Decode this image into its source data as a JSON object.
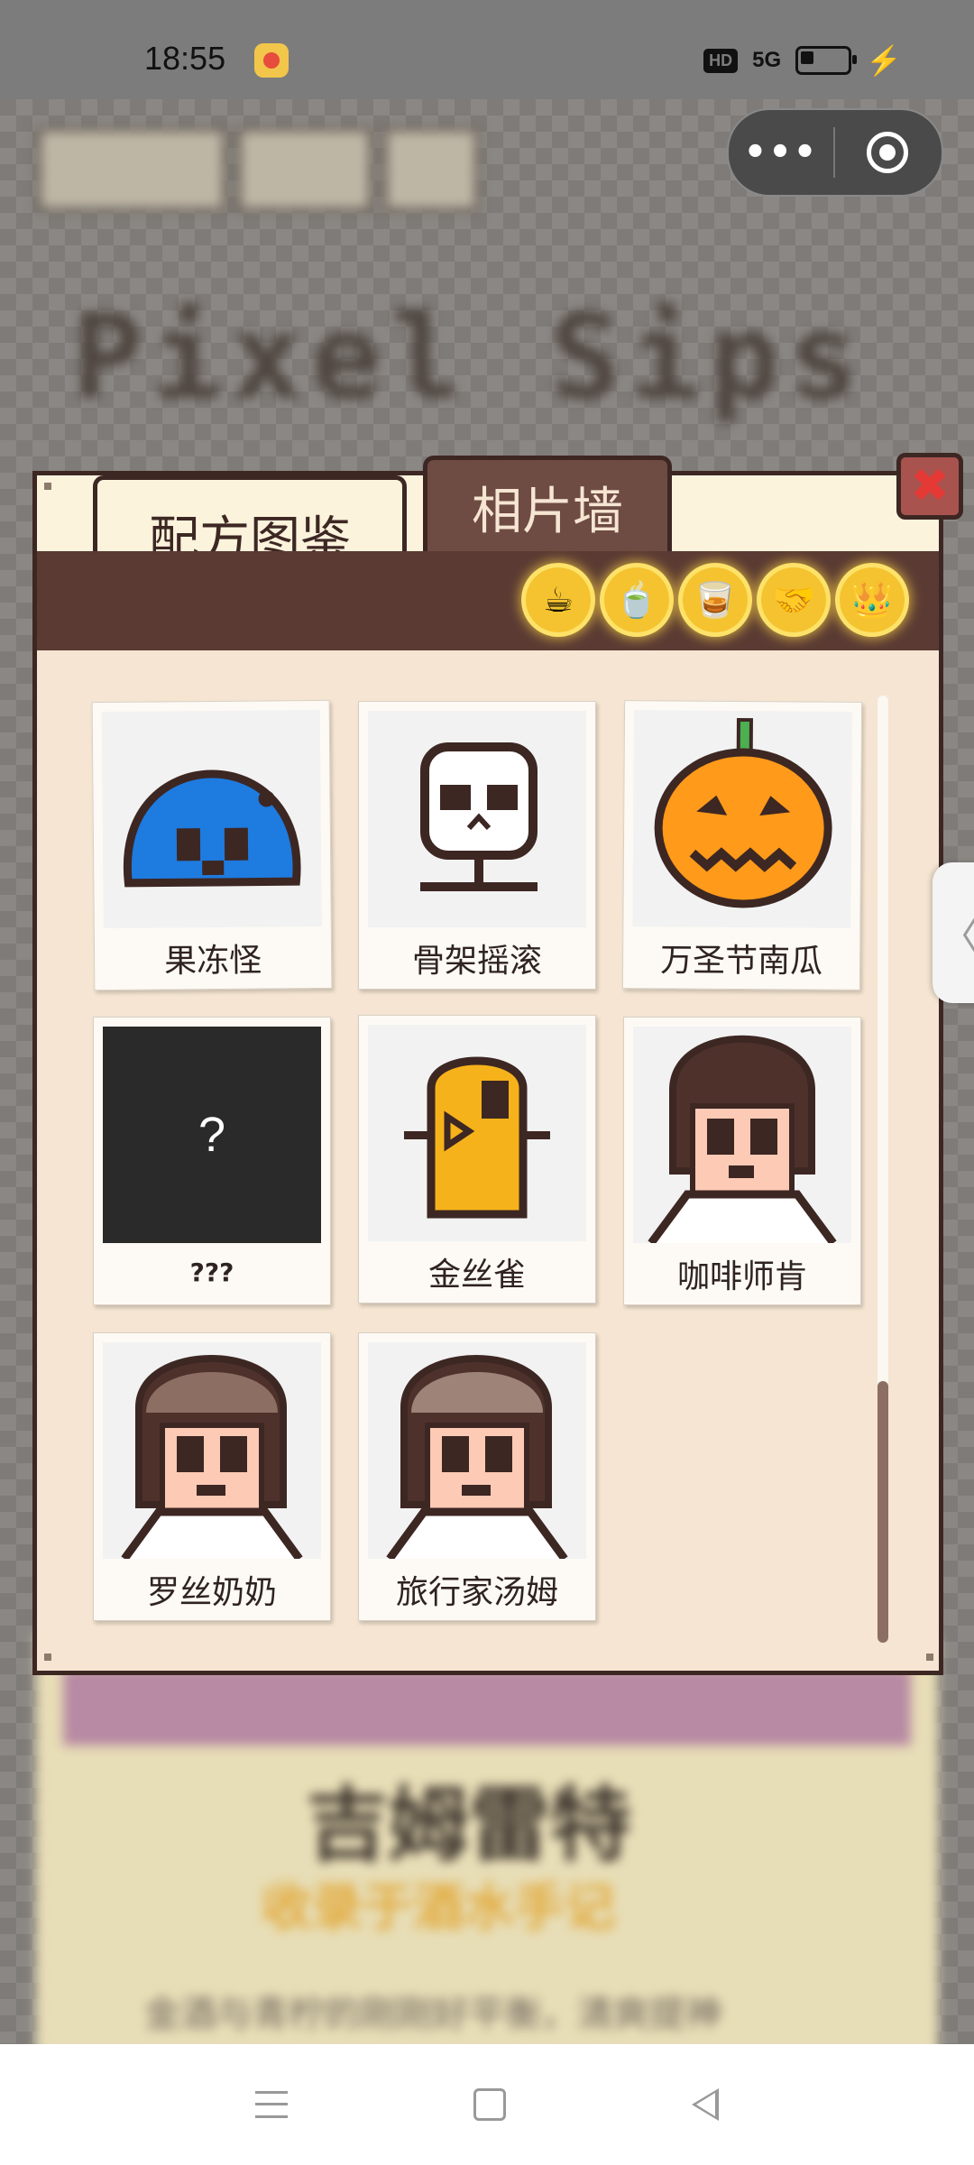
{
  "status_bar": {
    "time": "18:55",
    "network_badge": "HD",
    "signal": "5G",
    "app_icon": "weibo-icon"
  },
  "background_page": {
    "title": "Pixel Sips",
    "name": "吉姆雷特",
    "subtitle": "收录于酒水手记",
    "text": "金酒与青柠的刚刚好平衡，清爽提神"
  },
  "capsule": {
    "more_label": "•••"
  },
  "modal": {
    "tabs": [
      {
        "label": "配方图鉴",
        "active": false
      },
      {
        "label": "相片墙",
        "active": true
      }
    ],
    "filters": [
      {
        "icon": "coffee-cup-icon",
        "glyph": "☕"
      },
      {
        "icon": "matcha-tea-icon",
        "glyph": "🍵"
      },
      {
        "icon": "whiskey-glass-icon",
        "glyph": "🥃"
      },
      {
        "icon": "handshake-icon",
        "glyph": "🤝"
      },
      {
        "icon": "crown-icon",
        "glyph": "👑"
      }
    ],
    "photos": [
      {
        "label": "果冻怪",
        "icon": "blue-slime-icon"
      },
      {
        "label": "骨架摇滚",
        "icon": "skeleton-icon"
      },
      {
        "label": "万圣节南瓜",
        "icon": "pumpkin-icon"
      },
      {
        "label": "???",
        "icon": "locked-photo-icon",
        "placeholder": "?"
      },
      {
        "label": "金丝雀",
        "icon": "canary-icon"
      },
      {
        "label": "咖啡师肯",
        "icon": "barista-ken-icon"
      },
      {
        "label": "罗丝奶奶",
        "icon": "grandma-rose-icon"
      },
      {
        "label": "旅行家汤姆",
        "icon": "traveler-tom-icon"
      }
    ],
    "close_glyph": "✖"
  },
  "side_tab": {
    "glyph": "〈"
  },
  "colors": {
    "modal_bg": "#f5e5d2",
    "border": "#3d2723",
    "header": "#5a3a33",
    "active_tab": "#6e4b43",
    "coin": "#f5c32f",
    "scroll_thumb": "#8d6e63"
  }
}
